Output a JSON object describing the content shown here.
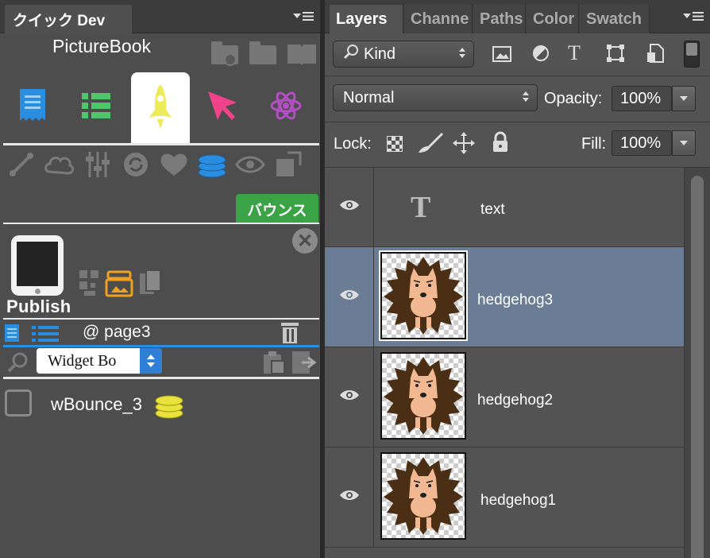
{
  "left_panel": {
    "tab_title": "クイック Dev",
    "app_title": "PictureBook",
    "bounce_button": "バウンス",
    "publish_label": "Publish",
    "page_label": "@ page3",
    "widget_select_value": "Widget Bo",
    "widget_item_label": "wBounce_3",
    "icons": {
      "top": [
        "folder-download-icon",
        "folder-open-icon",
        "book-icon"
      ],
      "main_tabs": [
        "receipt-icon",
        "list-icon",
        "rocket-icon",
        "pointer-icon",
        "atom-icon"
      ],
      "tools": [
        "line-icon",
        "cloud-icon",
        "sliders-icon",
        "refresh-icon",
        "heart-icon",
        "coins-icon",
        "eye-icon",
        "resize-icon"
      ]
    },
    "colors": {
      "bounce_green": "#3aa346",
      "accent_blue": "#2a8ee0",
      "rocket_yellow": "#ecec5a",
      "pointer_pink": "#f0438c",
      "atom_purple": "#b44ec4",
      "coin_yellow": "#e8e23a"
    }
  },
  "right_panel": {
    "tabs": [
      "Layers",
      "Channe",
      "Paths",
      "Color",
      "Swatch"
    ],
    "filter_select": "Kind",
    "blend_mode": "Normal",
    "opacity_label": "Opacity:",
    "opacity_value": "100%",
    "lock_label": "Lock:",
    "fill_label": "Fill:",
    "fill_value": "100%",
    "layers": [
      {
        "name": "text",
        "type": "text",
        "selected": false
      },
      {
        "name": "hedgehog3",
        "type": "image",
        "selected": true
      },
      {
        "name": "hedgehog2",
        "type": "image",
        "selected": false
      },
      {
        "name": "hedgehog1",
        "type": "image",
        "selected": false
      }
    ],
    "colors": {
      "selected_row": "#6a7d95"
    }
  }
}
